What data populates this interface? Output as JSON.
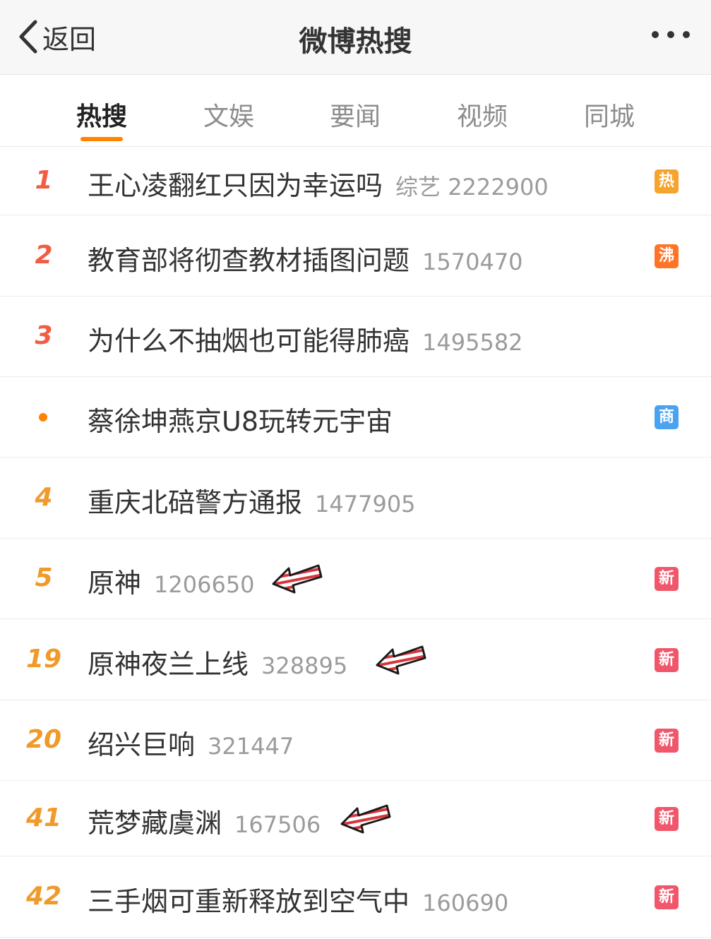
{
  "header": {
    "back_label": "返回",
    "title": "微博热搜"
  },
  "tabs": [
    {
      "label": "热搜",
      "active": true
    },
    {
      "label": "文娱",
      "active": false
    },
    {
      "label": "要闻",
      "active": false
    },
    {
      "label": "视频",
      "active": false
    },
    {
      "label": "同城",
      "active": false
    }
  ],
  "colors": {
    "accent": "#ff8200",
    "rank_top": "#f25d42",
    "rank_normal": "#f09a2a",
    "badge_hot": "#f7a42c",
    "badge_boil": "#ff7426",
    "badge_ad": "#4aa3f0",
    "badge_new": "#f0576b"
  },
  "items": [
    {
      "rank": "1",
      "title": "王心凌翻红只因为幸运吗",
      "meta": "综艺 2222900",
      "badge": "热",
      "badge_type": "hot"
    },
    {
      "rank": "2",
      "title": "教育部将彻查教材插图问题",
      "meta": "1570470",
      "badge": "沸",
      "badge_type": "boil"
    },
    {
      "rank": "3",
      "title": "为什么不抽烟也可能得肺癌",
      "meta": "1495582",
      "badge": "",
      "badge_type": ""
    },
    {
      "rank": "",
      "title": "蔡徐坤燕京U8玩转元宇宙",
      "meta": "",
      "badge": "商",
      "badge_type": "ad"
    },
    {
      "rank": "4",
      "title": "重庆北碚警方通报",
      "meta": "1477905",
      "badge": "",
      "badge_type": ""
    },
    {
      "rank": "5",
      "title": "原神",
      "meta": "1206650",
      "badge": "新",
      "badge_type": "new"
    },
    {
      "rank": "19",
      "title": "原神夜兰上线",
      "meta": "328895",
      "badge": "新",
      "badge_type": "new"
    },
    {
      "rank": "20",
      "title": "绍兴巨响",
      "meta": "321447",
      "badge": "新",
      "badge_type": "new"
    },
    {
      "rank": "41",
      "title": "荒梦藏虞渊",
      "meta": "167506",
      "badge": "新",
      "badge_type": "new"
    },
    {
      "rank": "42",
      "title": "三手烟可重新释放到空气中",
      "meta": "160690",
      "badge": "新",
      "badge_type": "new"
    }
  ]
}
